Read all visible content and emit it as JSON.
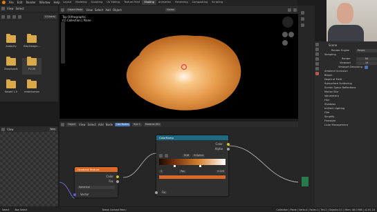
{
  "menubar": {
    "items": [
      "File",
      "Edit",
      "Render",
      "Window",
      "Help"
    ]
  },
  "workspace_tabs": [
    "Layout",
    "Modeling",
    "Sculpting",
    "UV Editing",
    "Texture Paint",
    "Shading",
    "Animation",
    "Rendering",
    "Compositing",
    "Scripting"
  ],
  "active_tab": "Shading",
  "filebrowser": {
    "header": {
      "view": "View",
      "select": "Select",
      "path_label": "C:\\Users\\"
    },
    "folders": [
      {
        "name": "Audacity"
      },
      {
        "name": "Blackmagic..."
      },
      {
        "name": "Downloads"
      },
      {
        "name": "FCCM"
      },
      {
        "name": "Kosatil 1.5"
      },
      {
        "name": "makehuman"
      }
    ]
  },
  "viewport": {
    "mode": "Object Mode",
    "view": "View",
    "select": "Select",
    "add": "Add",
    "object": "Object",
    "info_line1": "Top Orthographic",
    "info_line2": "(1) Collection | Plane",
    "shading": "Global"
  },
  "properties": {
    "scene": "Scene",
    "render_engine_label": "Render Engine",
    "render_engine": "Eevee",
    "sampling": "Sampling",
    "render_label": "Render",
    "render_val": "64",
    "viewport_label": "Viewport",
    "viewport_val": "16",
    "denoise": "Viewport Denoising",
    "sections": [
      "Ambient Occlusion",
      "Bloom",
      "Depth of Field",
      "Subsurface Scattering",
      "Screen Space Reflections",
      "Motion Blur",
      "Volumetrics",
      "Hair",
      "Shadows",
      "Indirect Lighting",
      "Film",
      "Simplify",
      "Freestyle",
      "Color Management"
    ]
  },
  "node_editor": {
    "header": [
      "Object",
      "View",
      "Select",
      "Add",
      "Node",
      "Use Nodes",
      "Slot 1",
      "Material.001"
    ],
    "colorramp": {
      "title": "ColorRamp",
      "out_color": "Color",
      "out_alpha": "Alpha",
      "mode": "RGB",
      "interp": "B-Spline",
      "index": "1",
      "pos_label": "Pos",
      "pos_val": "0.225",
      "fac": "Fac"
    },
    "gradient": {
      "title": "Gradient Texture",
      "out_color": "Color",
      "out_fac": "Fac",
      "type": "Spherical",
      "vector": "Vector"
    }
  },
  "image_editor": {
    "view": "View",
    "new": "New"
  },
  "statusbar": {
    "left": "Select",
    "mid1": "Box Select",
    "mid2": "Tweak Context Menu",
    "right": "Collection | Plane | Verts:4 | Faces:1 | Tris:2 | Objects:1/1 | Mem: 46.0 MiB | v2.81.16"
  },
  "colors": {
    "accent": "#4772b3",
    "ramp_header": "#1f6a80",
    "gradient_header": "#d96a27",
    "node_link": "#c2c2c2"
  }
}
